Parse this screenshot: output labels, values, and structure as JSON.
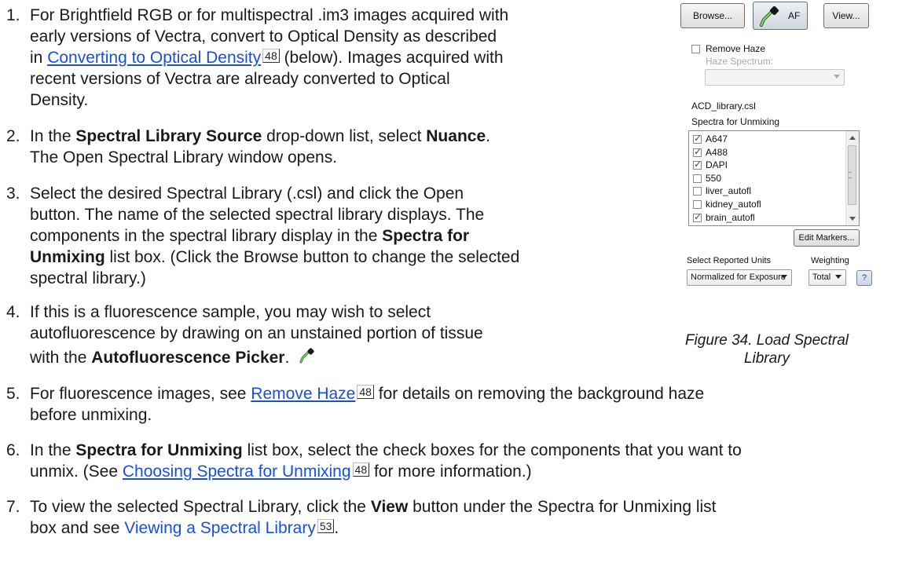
{
  "steps": [
    {
      "number": "1.",
      "line1": "For Brightfield RGB or for multispectral .im3 images acquired with",
      "line2": "early versions of Vectra, convert to Optical Density as described",
      "line3_prefix": "in ",
      "line3_link": "Converting to Optical Density",
      "line3_ref": "48",
      "line3_suffix": " (below). Images acquired with",
      "line4": "recent versions of Vectra are already converted to Optical",
      "line5": "Density."
    },
    {
      "number": "2.",
      "line1_prefix": "In the ",
      "line1_bold": "Spectral Library Source",
      "line1_mid": " drop-down list, select ",
      "line1_bold2": "Nuance",
      "line1_suffix": ".",
      "line2": "The Open Spectral Library window opens."
    },
    {
      "number": "3.",
      "line1": "Select the desired Spectral Library (.csl) and click the Open",
      "line2": "button. The name of the selected spectral library displays. The",
      "line3_prefix": "components in the spectral library display in the ",
      "line3_bold": "Spectra for",
      "line4_bold": "Unmixing",
      "line4_suffix": " list box. (Click the Browse button to change the selected",
      "line5": "spectral library.)"
    },
    {
      "number": "4.",
      "line1": "If this is a fluorescence sample, you may wish to select",
      "line2": "autofluorescence by drawing on an unstained portion of tissue",
      "line3_prefix": "with the ",
      "line3_bold": "Autofluorescence Picker",
      "line3_suffix": ".",
      "icon": "eyedropper-icon"
    },
    {
      "number": "5.",
      "line1_prefix": "For fluorescence images, see ",
      "line1_link": "Remove Haze",
      "line1_ref": "48",
      "line1_suffix": " for details on removing the background haze",
      "line2": "before unmixing."
    },
    {
      "number": "6.",
      "line1_prefix": "In the ",
      "line1_bold": "Spectra for Unmixing",
      "line1_suffix": " list box, select the check boxes for the components that you want to",
      "line2_prefix": "unmix. (See ",
      "line2_link": "Choosing Spectra for Unmixing",
      "line2_ref": "48",
      "line2_suffix": " for more information.)"
    },
    {
      "number": "7.",
      "line1_prefix": "To view the selected Spectral Library, click the ",
      "line1_bold": "View",
      "line1_suffix": " button under the Spectra for Unmixing list",
      "line2_prefix": "box and see ",
      "line2_link": "Viewing a Spectral Library",
      "line2_ref": "53",
      "line2_suffix": "."
    }
  ],
  "panel": {
    "browse_label": "Browse...",
    "af_label": "AF",
    "view_label": "View...",
    "remove_haze_label": "Remove Haze",
    "remove_haze_checked": false,
    "haze_spectrum_label": "Haze Spectrum:",
    "haze_spectrum_value": "",
    "library_name": "ACD_library.csl",
    "spectra_label": "Spectra for Unmixing",
    "spectra": [
      {
        "name": "A647",
        "checked": true
      },
      {
        "name": "A488",
        "checked": true
      },
      {
        "name": "DAPI",
        "checked": true
      },
      {
        "name": "550",
        "checked": false
      },
      {
        "name": "liver_autofl",
        "checked": false
      },
      {
        "name": "kidney_autofl",
        "checked": false
      },
      {
        "name": "brain_autofl",
        "checked": true
      }
    ],
    "edit_markers_label": "Edit Markers...",
    "reported_units_label": "Select Reported Units",
    "reported_units_value": "Normalized for Exposure",
    "weighting_label": "Weighting",
    "weighting_value": "Total",
    "help_label": "?"
  },
  "caption": {
    "line1": "Figure 34. Load Spectral",
    "line2": "Library"
  }
}
